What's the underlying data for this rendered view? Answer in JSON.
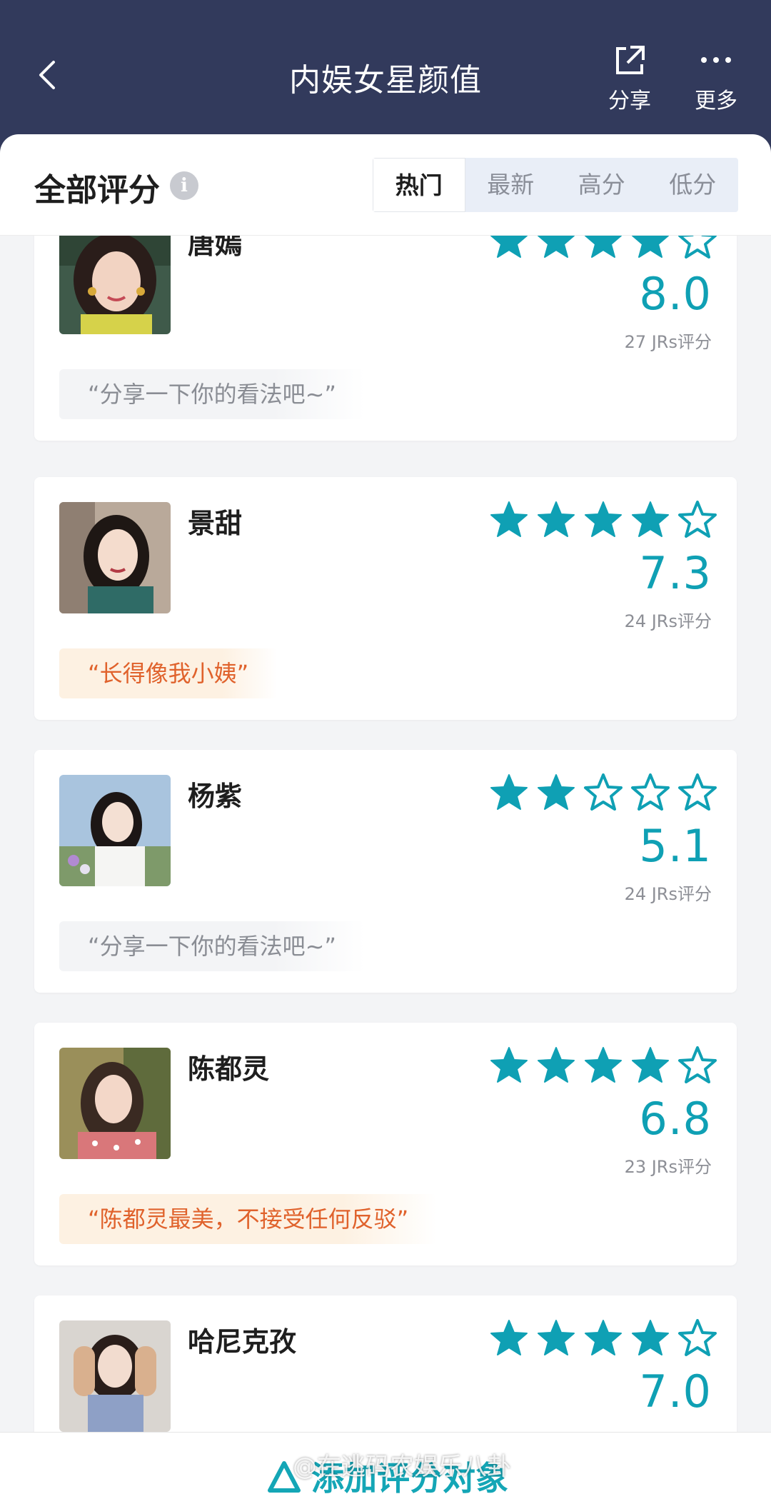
{
  "header": {
    "title": "内娱女星颜值",
    "share_label": "分享",
    "more_label": "更多"
  },
  "section": {
    "title": "全部评分",
    "info_icon": "info-icon"
  },
  "tabs": [
    {
      "label": "热门",
      "active": true
    },
    {
      "label": "最新",
      "active": false
    },
    {
      "label": "高分",
      "active": false
    },
    {
      "label": "低分",
      "active": false
    }
  ],
  "items": [
    {
      "name": "唐嫣",
      "stars_filled": 4,
      "stars_total": 5,
      "score": "8.0",
      "count": "27 JRs评分",
      "comment": "“分享一下你的看法吧~”",
      "comment_type": "placeholder"
    },
    {
      "name": "景甜",
      "stars_filled": 4,
      "stars_total": 5,
      "score": "7.3",
      "count": "24 JRs评分",
      "comment": "“长得像我小姨”",
      "comment_type": "hot"
    },
    {
      "name": "杨紫",
      "stars_filled": 2,
      "stars_total": 5,
      "score": "5.1",
      "count": "24 JRs评分",
      "comment": "“分享一下你的看法吧~”",
      "comment_type": "placeholder"
    },
    {
      "name": "陈都灵",
      "stars_filled": 4,
      "stars_total": 5,
      "score": "6.8",
      "count": "23 JRs评分",
      "comment": "“陈都灵最美，不接受任何反驳”",
      "comment_type": "hot"
    },
    {
      "name": "哈尼克孜",
      "stars_filled": 4,
      "stars_total": 5,
      "score": "7.0",
      "count": "",
      "comment": "",
      "comment_type": "none"
    }
  ],
  "bottom": {
    "add_label": "添加评分对象",
    "watermark": "@在逃码农娱乐八卦"
  },
  "colors": {
    "header_bg": "#323a5c",
    "accent": "#0fa0b4",
    "hot_comment": "#e0622c"
  }
}
